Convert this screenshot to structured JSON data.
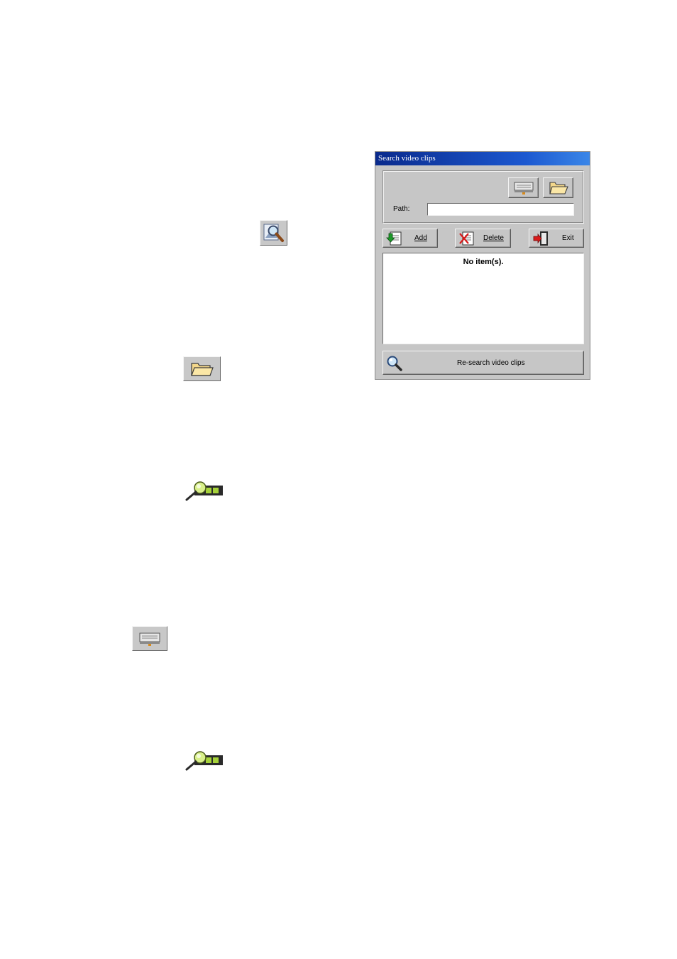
{
  "dialog": {
    "title": "Search video clips",
    "path_label": "Path:",
    "path_value": "",
    "buttons": {
      "add": "Add",
      "delete": "Delete",
      "exit": "Exit",
      "research": "Re-search video clips"
    },
    "list": {
      "empty_text": "No item(s)."
    },
    "icons": {
      "drive": "drive-icon",
      "folder": "folder-open-icon",
      "add": "add-file-icon",
      "delete": "delete-file-icon",
      "exit": "exit-door-icon",
      "research": "magnifier-icon"
    }
  },
  "page_icons": [
    "search-clips-icon",
    "folder-open-icon",
    "play-search-icon",
    "drive-icon",
    "play-search-icon"
  ]
}
